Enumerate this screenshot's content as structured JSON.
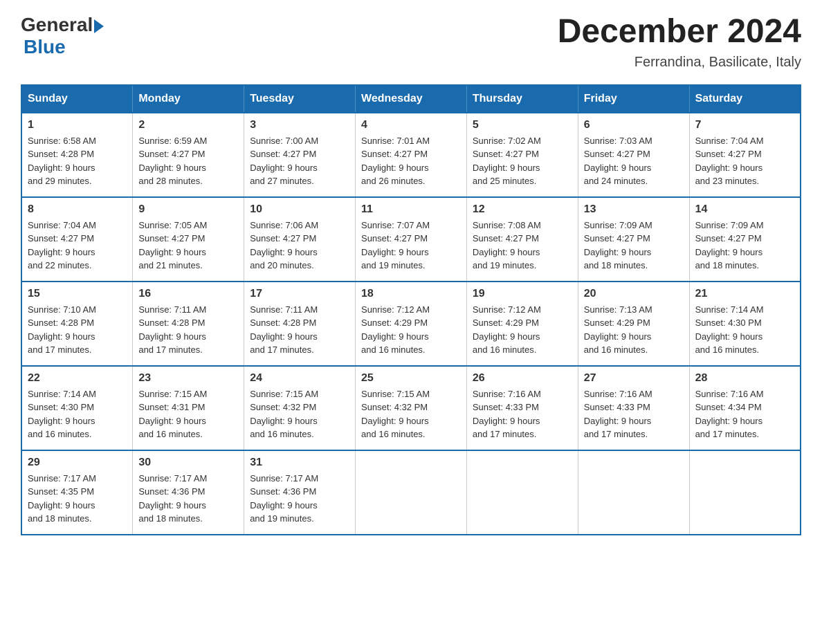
{
  "logo": {
    "general": "General",
    "blue": "Blue"
  },
  "title": "December 2024",
  "location": "Ferrandina, Basilicate, Italy",
  "days_of_week": [
    "Sunday",
    "Monday",
    "Tuesday",
    "Wednesday",
    "Thursday",
    "Friday",
    "Saturday"
  ],
  "weeks": [
    [
      {
        "day": "1",
        "sunrise": "6:58 AM",
        "sunset": "4:28 PM",
        "daylight": "9 hours and 29 minutes."
      },
      {
        "day": "2",
        "sunrise": "6:59 AM",
        "sunset": "4:27 PM",
        "daylight": "9 hours and 28 minutes."
      },
      {
        "day": "3",
        "sunrise": "7:00 AM",
        "sunset": "4:27 PM",
        "daylight": "9 hours and 27 minutes."
      },
      {
        "day": "4",
        "sunrise": "7:01 AM",
        "sunset": "4:27 PM",
        "daylight": "9 hours and 26 minutes."
      },
      {
        "day": "5",
        "sunrise": "7:02 AM",
        "sunset": "4:27 PM",
        "daylight": "9 hours and 25 minutes."
      },
      {
        "day": "6",
        "sunrise": "7:03 AM",
        "sunset": "4:27 PM",
        "daylight": "9 hours and 24 minutes."
      },
      {
        "day": "7",
        "sunrise": "7:04 AM",
        "sunset": "4:27 PM",
        "daylight": "9 hours and 23 minutes."
      }
    ],
    [
      {
        "day": "8",
        "sunrise": "7:04 AM",
        "sunset": "4:27 PM",
        "daylight": "9 hours and 22 minutes."
      },
      {
        "day": "9",
        "sunrise": "7:05 AM",
        "sunset": "4:27 PM",
        "daylight": "9 hours and 21 minutes."
      },
      {
        "day": "10",
        "sunrise": "7:06 AM",
        "sunset": "4:27 PM",
        "daylight": "9 hours and 20 minutes."
      },
      {
        "day": "11",
        "sunrise": "7:07 AM",
        "sunset": "4:27 PM",
        "daylight": "9 hours and 19 minutes."
      },
      {
        "day": "12",
        "sunrise": "7:08 AM",
        "sunset": "4:27 PM",
        "daylight": "9 hours and 19 minutes."
      },
      {
        "day": "13",
        "sunrise": "7:09 AM",
        "sunset": "4:27 PM",
        "daylight": "9 hours and 18 minutes."
      },
      {
        "day": "14",
        "sunrise": "7:09 AM",
        "sunset": "4:27 PM",
        "daylight": "9 hours and 18 minutes."
      }
    ],
    [
      {
        "day": "15",
        "sunrise": "7:10 AM",
        "sunset": "4:28 PM",
        "daylight": "9 hours and 17 minutes."
      },
      {
        "day": "16",
        "sunrise": "7:11 AM",
        "sunset": "4:28 PM",
        "daylight": "9 hours and 17 minutes."
      },
      {
        "day": "17",
        "sunrise": "7:11 AM",
        "sunset": "4:28 PM",
        "daylight": "9 hours and 17 minutes."
      },
      {
        "day": "18",
        "sunrise": "7:12 AM",
        "sunset": "4:29 PM",
        "daylight": "9 hours and 16 minutes."
      },
      {
        "day": "19",
        "sunrise": "7:12 AM",
        "sunset": "4:29 PM",
        "daylight": "9 hours and 16 minutes."
      },
      {
        "day": "20",
        "sunrise": "7:13 AM",
        "sunset": "4:29 PM",
        "daylight": "9 hours and 16 minutes."
      },
      {
        "day": "21",
        "sunrise": "7:14 AM",
        "sunset": "4:30 PM",
        "daylight": "9 hours and 16 minutes."
      }
    ],
    [
      {
        "day": "22",
        "sunrise": "7:14 AM",
        "sunset": "4:30 PM",
        "daylight": "9 hours and 16 minutes."
      },
      {
        "day": "23",
        "sunrise": "7:15 AM",
        "sunset": "4:31 PM",
        "daylight": "9 hours and 16 minutes."
      },
      {
        "day": "24",
        "sunrise": "7:15 AM",
        "sunset": "4:32 PM",
        "daylight": "9 hours and 16 minutes."
      },
      {
        "day": "25",
        "sunrise": "7:15 AM",
        "sunset": "4:32 PM",
        "daylight": "9 hours and 16 minutes."
      },
      {
        "day": "26",
        "sunrise": "7:16 AM",
        "sunset": "4:33 PM",
        "daylight": "9 hours and 17 minutes."
      },
      {
        "day": "27",
        "sunrise": "7:16 AM",
        "sunset": "4:33 PM",
        "daylight": "9 hours and 17 minutes."
      },
      {
        "day": "28",
        "sunrise": "7:16 AM",
        "sunset": "4:34 PM",
        "daylight": "9 hours and 17 minutes."
      }
    ],
    [
      {
        "day": "29",
        "sunrise": "7:17 AM",
        "sunset": "4:35 PM",
        "daylight": "9 hours and 18 minutes."
      },
      {
        "day": "30",
        "sunrise": "7:17 AM",
        "sunset": "4:36 PM",
        "daylight": "9 hours and 18 minutes."
      },
      {
        "day": "31",
        "sunrise": "7:17 AM",
        "sunset": "4:36 PM",
        "daylight": "9 hours and 19 minutes."
      },
      null,
      null,
      null,
      null
    ]
  ],
  "labels": {
    "sunrise": "Sunrise:",
    "sunset": "Sunset:",
    "daylight": "Daylight:"
  }
}
